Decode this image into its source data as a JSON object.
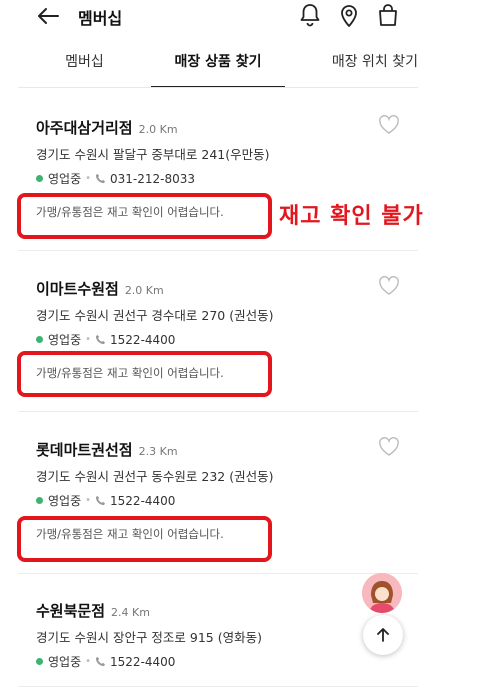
{
  "header": {
    "title": "멤버십",
    "back_icon": "arrow-left-icon",
    "icons": [
      "bell-icon",
      "location-pin-icon",
      "shopping-bag-icon"
    ]
  },
  "tabs": [
    {
      "label": "멤버십",
      "active": false
    },
    {
      "label": "매장 상품 찾기",
      "active": true
    },
    {
      "label": "매장 위치 찾기",
      "active": false
    }
  ],
  "stores": [
    {
      "name": "아주대삼거리점",
      "distance": "2.0 Km",
      "address": "경기도 수원시 팔달구 중부대로 241(우만동)",
      "status": "영업중",
      "phone": "031-212-8033",
      "notice": "가맹/유통점은 재고 확인이 어렵습니다."
    },
    {
      "name": "이마트수원점",
      "distance": "2.0 Km",
      "address": "경기도 수원시 권선구 경수대로 270 (권선동)",
      "status": "영업중",
      "phone": "1522-4400",
      "notice": "가맹/유통점은 재고 확인이 어렵습니다."
    },
    {
      "name": "롯데마트권선점",
      "distance": "2.3 Km",
      "address": "경기도 수원시 권선구 동수원로 232 (권선동)",
      "status": "영업중",
      "phone": "1522-4400",
      "notice": "가맹/유통점은 재고 확인이 어렵습니다."
    },
    {
      "name": "수원북문점",
      "distance": "2.4 Km",
      "address": "경기도 수원시 장안구 정조로 915 (영화동)",
      "status": "영업중",
      "phone": "1522-4400"
    }
  ],
  "annotation": {
    "callout": "재고 확인 불가",
    "color": "#e3161e"
  },
  "colors": {
    "open_dot": "#3cb371",
    "accent_red": "#e3161e"
  }
}
